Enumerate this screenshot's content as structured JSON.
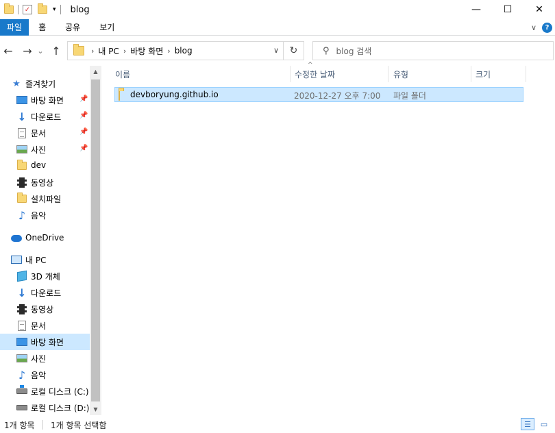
{
  "window": {
    "title": "blog",
    "controls": {
      "minimize": "—",
      "maximize": "☐",
      "close": "✕"
    }
  },
  "ribbon": {
    "tabs": [
      "파일",
      "홈",
      "공유",
      "보기"
    ],
    "expand_icon": "chevron-down-icon",
    "help_icon": "?"
  },
  "address": {
    "crumbs": [
      "내 PC",
      "바탕 화면",
      "blog"
    ],
    "refresh": "↻"
  },
  "search": {
    "placeholder": "blog 검색"
  },
  "nav": {
    "quick_access": "즐겨찾기",
    "quick_items": [
      {
        "label": "바탕 화면",
        "icon": "desktop-icon",
        "pinned": true
      },
      {
        "label": "다운로드",
        "icon": "download-icon",
        "pinned": true
      },
      {
        "label": "문서",
        "icon": "document-icon",
        "pinned": true
      },
      {
        "label": "사진",
        "icon": "picture-icon",
        "pinned": true
      },
      {
        "label": "dev",
        "icon": "folder-icon",
        "pinned": false
      },
      {
        "label": "동영상",
        "icon": "video-icon",
        "pinned": false
      },
      {
        "label": "설치파일",
        "icon": "folder-icon",
        "pinned": false
      },
      {
        "label": "음악",
        "icon": "music-icon",
        "pinned": false
      }
    ],
    "onedrive": "OneDrive",
    "this_pc": "내 PC",
    "pc_items": [
      {
        "label": "3D 개체",
        "icon": "3d-objects-icon"
      },
      {
        "label": "다운로드",
        "icon": "download-icon"
      },
      {
        "label": "동영상",
        "icon": "video-icon"
      },
      {
        "label": "문서",
        "icon": "document-icon"
      },
      {
        "label": "바탕 화면",
        "icon": "desktop-icon",
        "selected": true
      },
      {
        "label": "사진",
        "icon": "picture-icon"
      },
      {
        "label": "음악",
        "icon": "music-icon"
      },
      {
        "label": "로컬 디스크 (C:)",
        "icon": "drive-icon"
      },
      {
        "label": "로컬 디스크 (D:)",
        "icon": "drive-icon"
      }
    ]
  },
  "columns": {
    "name": "이름",
    "modified": "수정한 날짜",
    "type": "유형",
    "size": "크기"
  },
  "files": [
    {
      "name": "devboryung.github.io",
      "modified": "2020-12-27 오후 7:00",
      "type": "파일 폴더",
      "size": "",
      "selected": true
    }
  ],
  "status": {
    "count": "1개 항목",
    "selection": "1개 항목 선택함"
  },
  "colors": {
    "accent": "#1979ca",
    "selection": "#cce8ff",
    "selection_border": "#99d1ff"
  }
}
